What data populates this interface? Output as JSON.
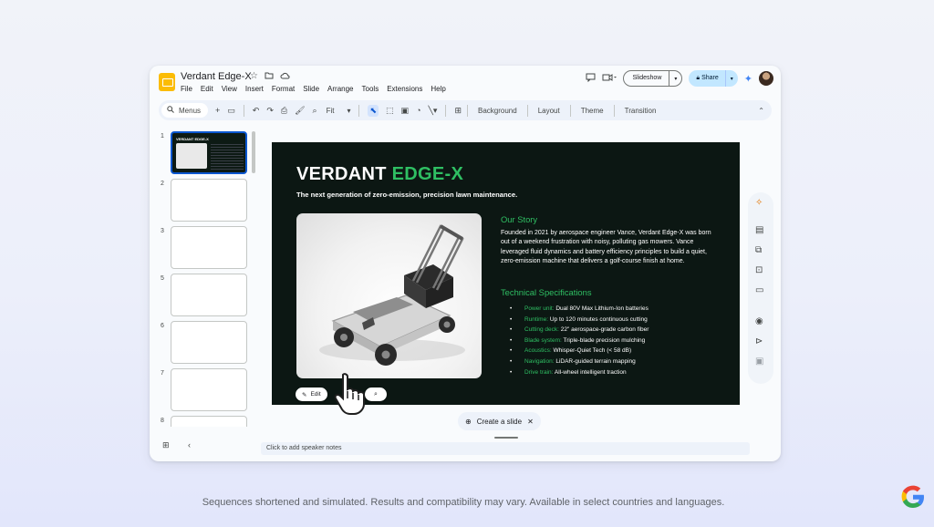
{
  "app": {
    "doc_title": "Verdant Edge-X",
    "menu": [
      "File",
      "Edit",
      "View",
      "Insert",
      "Format",
      "Slide",
      "Arrange",
      "Tools",
      "Extensions",
      "Help"
    ],
    "slideshow_label": "Slideshow",
    "share_label": "Share"
  },
  "toolbar": {
    "menus_label": "Menus",
    "zoom_label": "Fit",
    "background_label": "Background",
    "layout_label": "Layout",
    "theme_label": "Theme",
    "transition_label": "Transition"
  },
  "filmstrip": {
    "slide_numbers": [
      "1",
      "2",
      "3",
      "5",
      "6",
      "7",
      "8"
    ],
    "thumb_title": "VERDANT EDGE-X"
  },
  "slide": {
    "title_main": "VERDANT ",
    "title_accent": "EDGE-X",
    "subtitle": "The next generation of zero-emission, precision lawn maintenance.",
    "story_heading": "Our Story",
    "story_text": "Founded in 2021 by aerospace engineer Vance, Verdant Edge-X was born out of a weekend frustration with noisy, polluting gas mowers. Vance leveraged fluid dynamics and battery efficiency principles to build a quiet, zero-emission machine that delivers a golf-course finish at home.",
    "specs_heading": "Technical Specifications",
    "specs": [
      {
        "key": "Power unit:",
        "value": "Dual 80V Max Lithium-Ion batteries"
      },
      {
        "key": "Runtime:",
        "value": "Up to 120 minutes continuous cutting"
      },
      {
        "key": "Cutting deck:",
        "value": "22\" aerospace-grade carbon fiber"
      },
      {
        "key": "Blade system:",
        "value": "Triple-blade precision mulching"
      },
      {
        "key": "Acoustics:",
        "value": "Whisper-Quiet Tech (< 58 dB)"
      },
      {
        "key": "Navigation:",
        "value": "LiDAR-guided terrain mapping"
      },
      {
        "key": "Drive train:",
        "value": "All-wheel intelligent traction"
      }
    ]
  },
  "image_toolbar": {
    "edit_label": "Edit"
  },
  "bottom": {
    "create_slide_label": "Create a slide",
    "speaker_notes_placeholder": "Click to add speaker notes"
  },
  "footer": {
    "disclaimer": "Sequences shortened and simulated. Results and compatibility may vary. Available in select countries and languages."
  },
  "colors": {
    "accent_green": "#2fbf63",
    "slide_bg": "#0c1713",
    "share_bg": "#c2e7ff",
    "selection_blue": "#0b57d0"
  },
  "icons": [
    "star-icon",
    "move-folder-icon",
    "cloud-saved-icon",
    "comment-icon",
    "video-call-icon",
    "gemini-sparkle-icon",
    "search-icon",
    "undo-icon",
    "redo-icon",
    "print-icon",
    "paint-format-icon",
    "zoom-icon",
    "cursor-select-icon",
    "textbox-icon",
    "image-icon",
    "shapes-icon",
    "line-icon",
    "comment-add-icon",
    "chevron-up-icon",
    "pencil-icon",
    "grid-view-icon",
    "chevron-left-icon",
    "close-icon",
    "google-logo-icon"
  ]
}
